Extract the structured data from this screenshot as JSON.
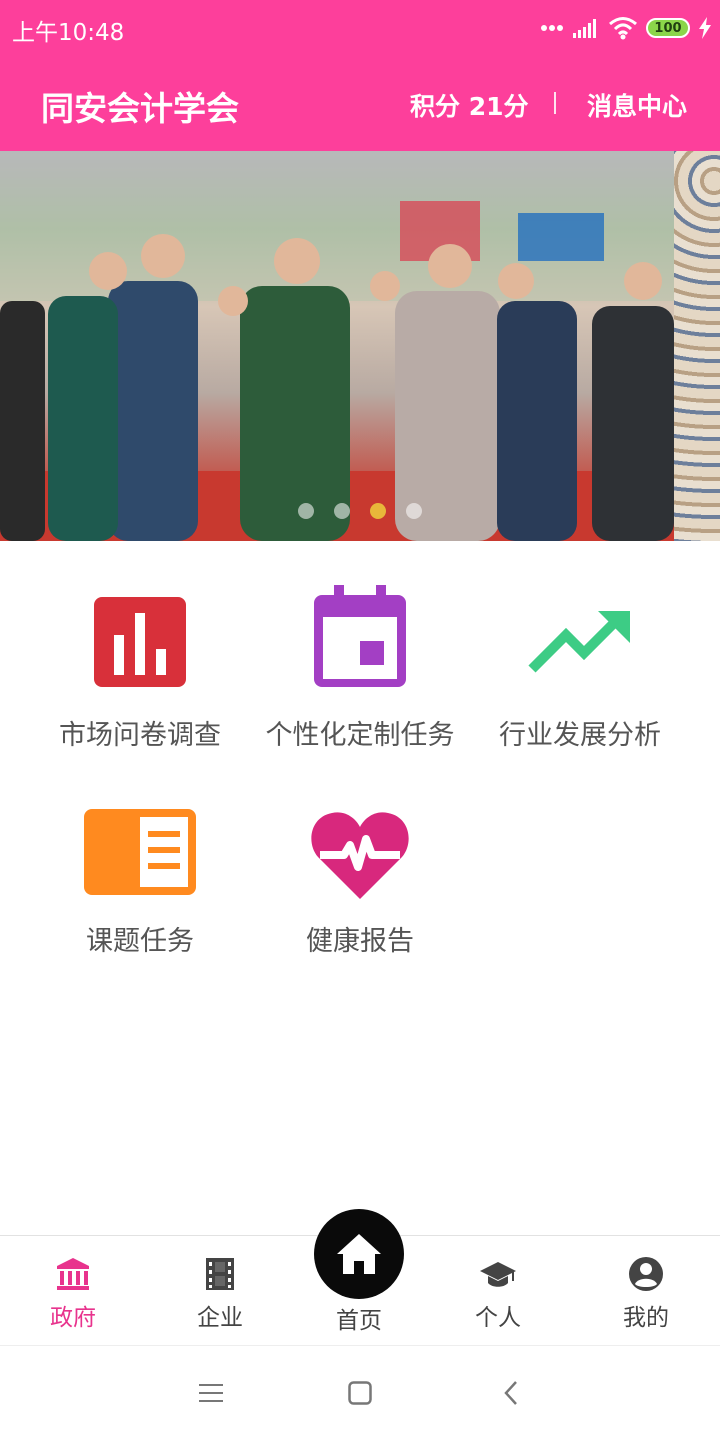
{
  "status": {
    "time": "上午10:48",
    "battery": "100"
  },
  "header": {
    "title": "同安会计学会",
    "points": "积分 21分",
    "messages": "消息中心",
    "bg_color": "#fd3f9b"
  },
  "banner": {
    "slide_count": 4,
    "active_index": 2
  },
  "features": [
    {
      "label": "市场问卷调查",
      "icon": "bar-chart-icon",
      "color": "#d8303a"
    },
    {
      "label": "个性化定制任务",
      "icon": "calendar-icon",
      "color": "#a33fc4"
    },
    {
      "label": "行业发展分析",
      "icon": "trending-up-icon",
      "color": "#3dcc85"
    },
    {
      "label": "课题任务",
      "icon": "article-icon",
      "color": "#ff8a1f"
    },
    {
      "label": "健康报告",
      "icon": "heart-pulse-icon",
      "color": "#d8287d"
    }
  ],
  "bottom_nav": {
    "items": [
      {
        "label": "政府",
        "icon": "institution-icon",
        "active": true
      },
      {
        "label": "企业",
        "icon": "film-icon",
        "active": false
      },
      {
        "label": "首页",
        "icon": "home-icon",
        "active": false
      },
      {
        "label": "个人",
        "icon": "graduation-cap-icon",
        "active": false
      },
      {
        "label": "我的",
        "icon": "account-circle-icon",
        "active": false
      }
    ],
    "active_color": "#e8338d"
  }
}
